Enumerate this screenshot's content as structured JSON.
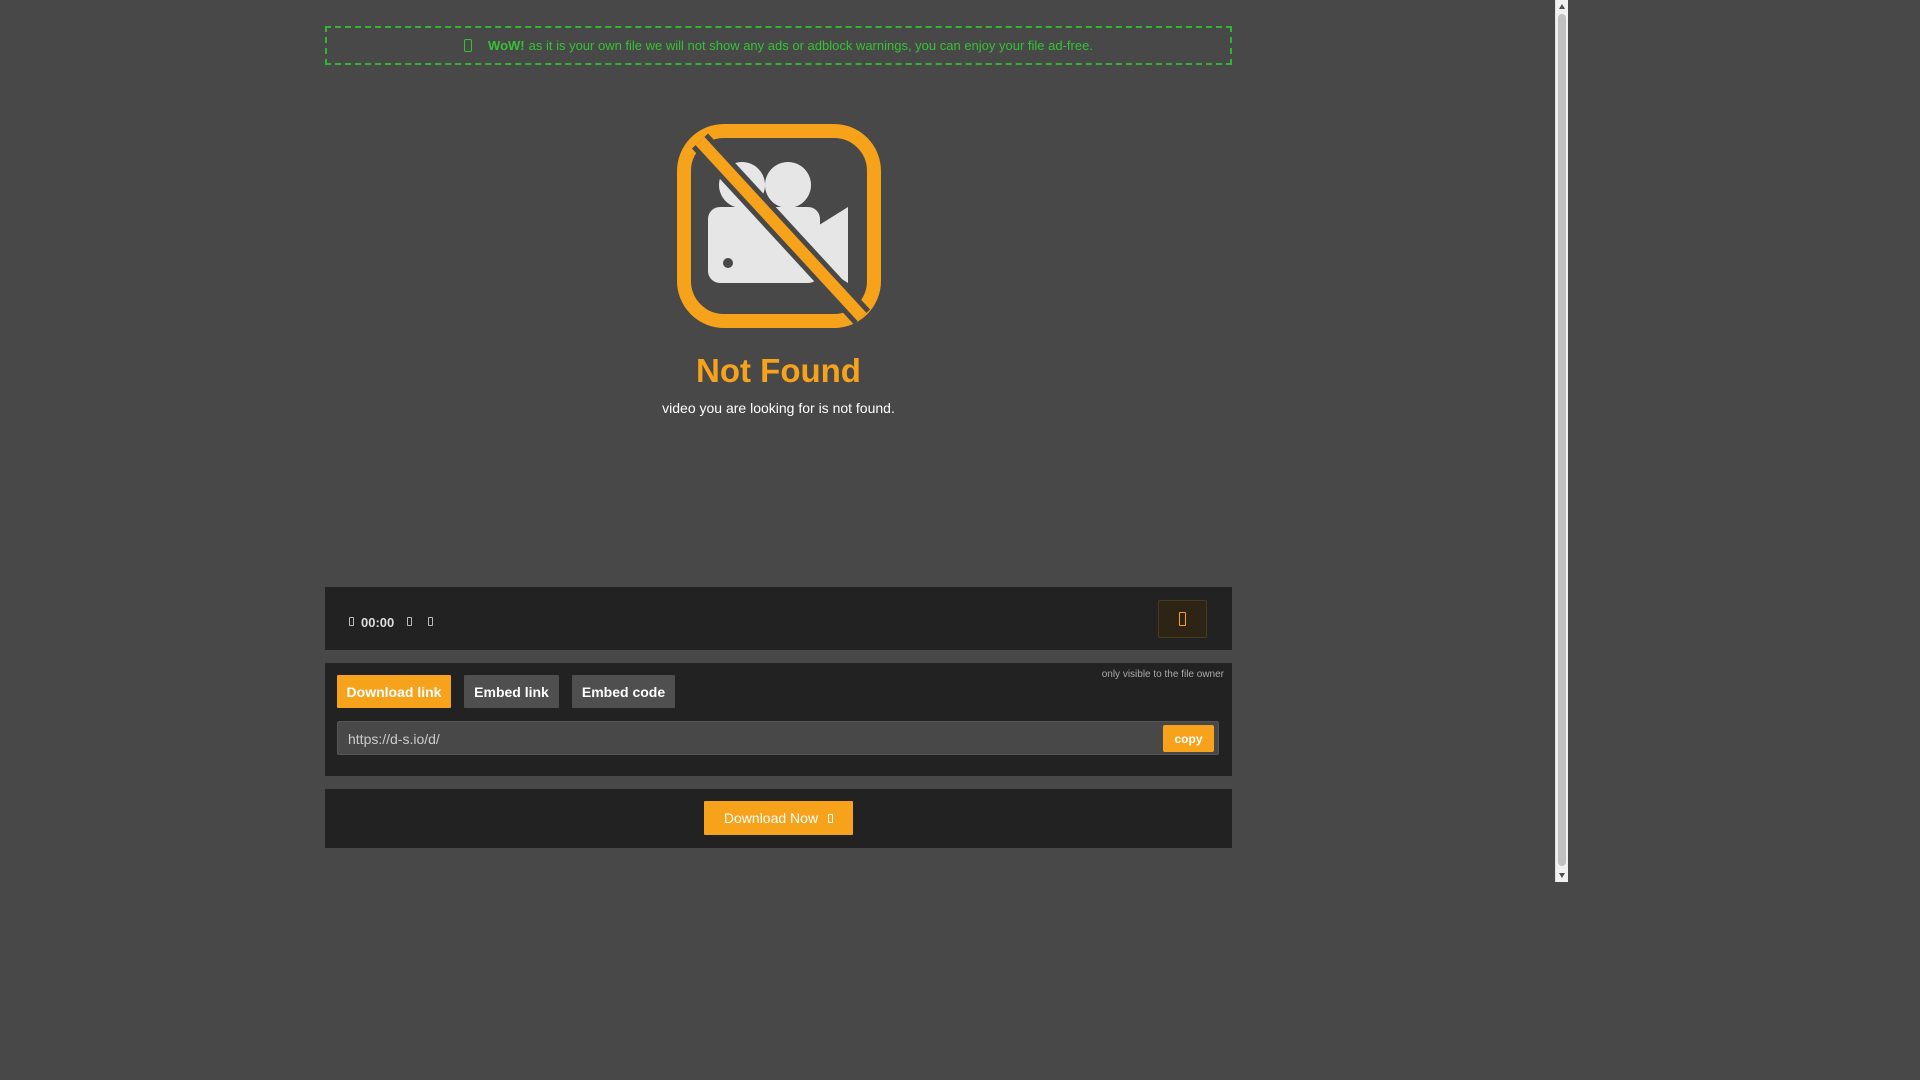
{
  "notice": {
    "strong": "WoW!",
    "text": "as it is your own file we will not show any ads or adblock warnings, you can enjoy your file ad-free.",
    "icon": "check-square-icon",
    "color": "#34c234"
  },
  "player": {
    "not_found_title": "Not Found",
    "not_found_message": "video you are looking for is not found.",
    "icon": "no-video-camera-icon",
    "accent": "#f7a21b"
  },
  "controls": {
    "time": "00:00",
    "icons": [
      "clock-icon",
      "volume-icon",
      "fullscreen-icon"
    ],
    "settings_icon": "settings-icon"
  },
  "share": {
    "owner_note": "only visible to the file owner",
    "tabs": [
      "Download link",
      "Embed link",
      "Embed code"
    ],
    "active_tab": "Download link",
    "link_value": "https://d-s.io/d/",
    "copy_label": "copy"
  },
  "download": {
    "label": "Download Now",
    "icon": "download-icon"
  }
}
